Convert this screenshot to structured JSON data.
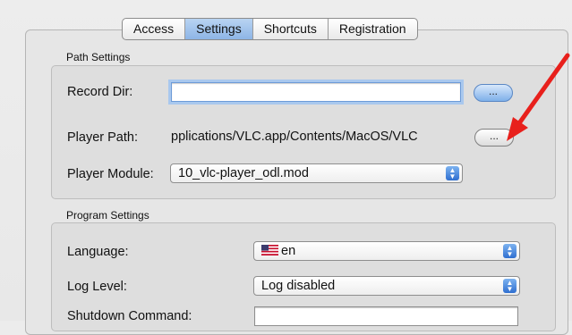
{
  "tabs": [
    {
      "label": "Access",
      "active": false
    },
    {
      "label": "Settings",
      "active": true
    },
    {
      "label": "Shortcuts",
      "active": false
    },
    {
      "label": "Registration",
      "active": false
    }
  ],
  "path_settings": {
    "group_label": "Path Settings",
    "record_dir_label": "Record Dir:",
    "record_dir_value": "",
    "record_browse_label": "...",
    "player_path_label": "Player Path:",
    "player_path_value": "pplications/VLC.app/Contents/MacOS/VLC",
    "player_browse_label": "...",
    "player_module_label": "Player Module:",
    "player_module_value": "10_vlc-player_odl.mod"
  },
  "program_settings": {
    "group_label": "Program Settings",
    "language_label": "Language:",
    "language_value": "en",
    "language_flag_icon": "us-flag-icon",
    "log_level_label": "Log Level:",
    "log_level_value": "Log disabled",
    "shutdown_label": "Shutdown Command:",
    "shutdown_value": ""
  },
  "annotation": {
    "arrow_color": "#e8201c"
  },
  "colors": {
    "accent": "#8db5e6",
    "button_primary": "#7fb0ea"
  }
}
